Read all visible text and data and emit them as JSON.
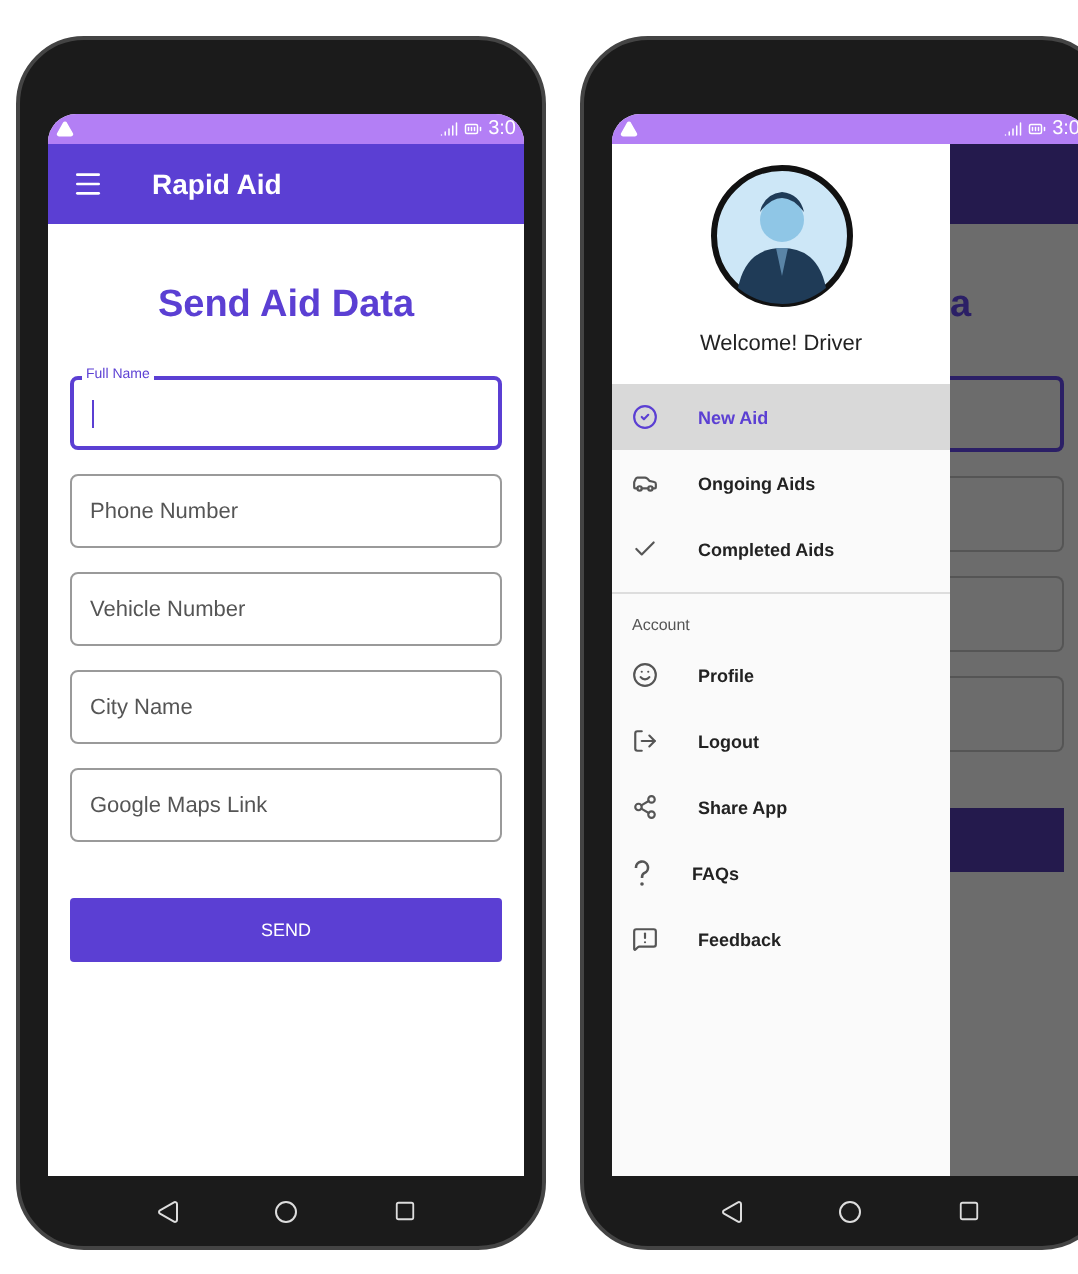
{
  "form_phone": {
    "status_bar": {
      "time": "3:0"
    },
    "app_bar": {
      "title": "Rapid Aid"
    },
    "heading": "Send Aid Data",
    "fields": [
      {
        "label": "Full Name",
        "focused": true
      },
      {
        "placeholder": "Phone Number",
        "focused": false
      },
      {
        "placeholder": "Vehicle Number",
        "focused": false
      },
      {
        "placeholder": "City Name",
        "focused": false
      },
      {
        "placeholder": "Google Maps Link",
        "focused": false
      }
    ],
    "button": "SEND"
  },
  "drawer_phone": {
    "status_bar": {
      "time": "3:0"
    },
    "drawer": {
      "greeting": "Welcome! Driver",
      "sections": [
        {
          "items": [
            {
              "label": "New Aid",
              "selected": true
            },
            {
              "label": "Ongoing Aids",
              "selected": false
            },
            {
              "label": "Completed Aids",
              "selected": false
            }
          ]
        },
        {
          "header": "Account",
          "items": [
            {
              "label": "Profile",
              "selected": false
            },
            {
              "label": "Logout",
              "selected": false
            },
            {
              "label": "Share App",
              "selected": false
            },
            {
              "label": "FAQs",
              "selected": false
            },
            {
              "label": "Feedback",
              "selected": false
            }
          ]
        }
      ]
    },
    "behind": {
      "heading": "a",
      "fields": [
        {
          "focused": true
        },
        {
          "focused": false
        },
        {
          "focused": false
        },
        {
          "focused": false
        }
      ]
    }
  }
}
